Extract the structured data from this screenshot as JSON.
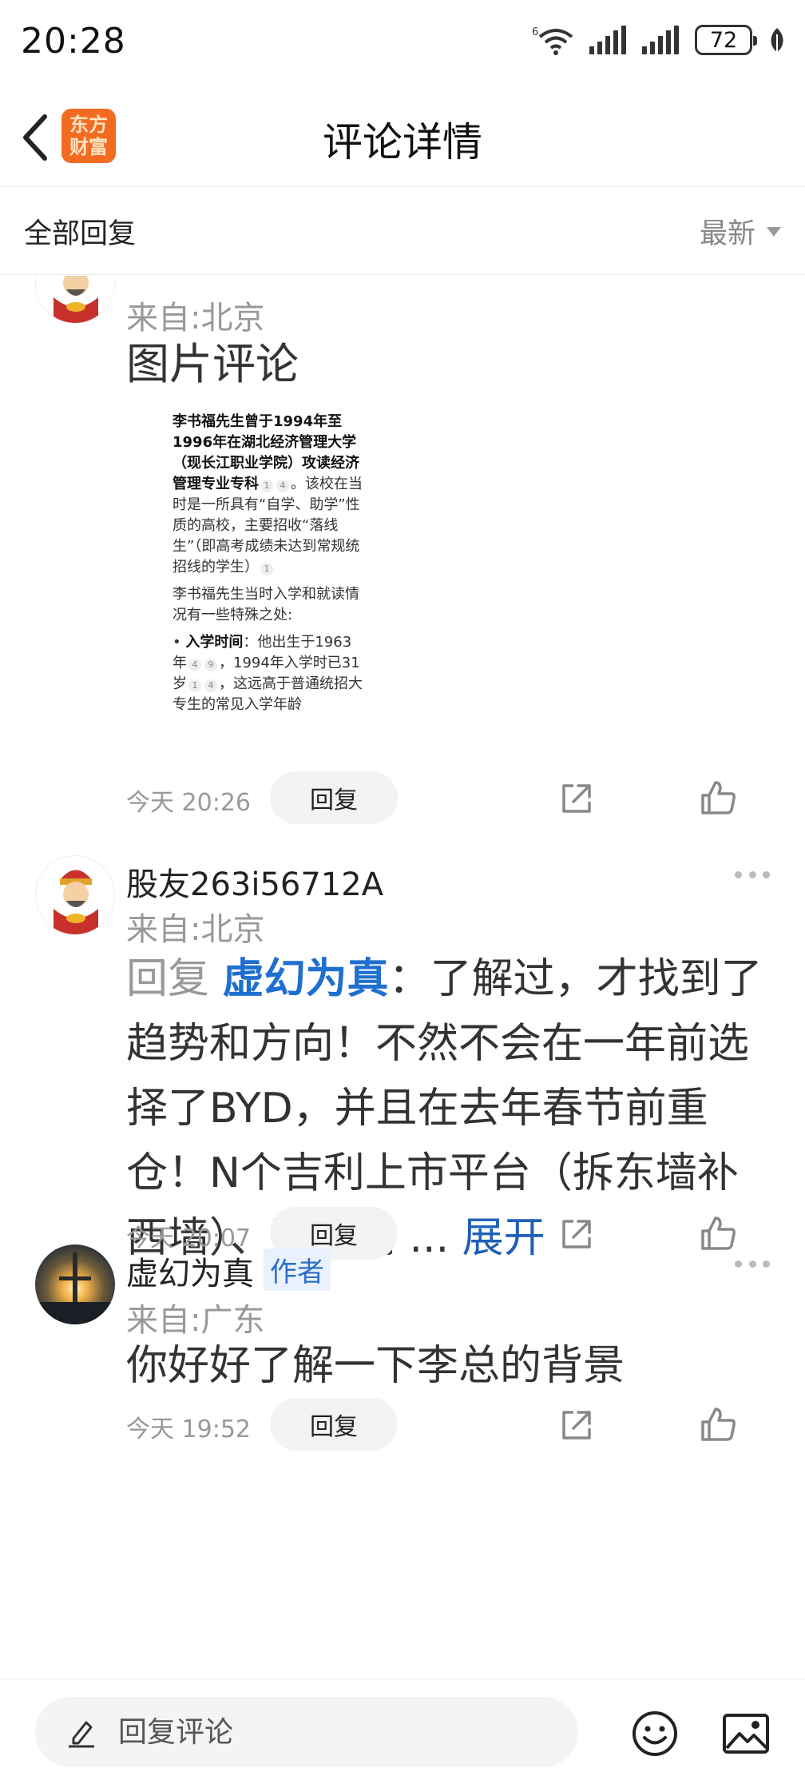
{
  "status_bar": {
    "time": "20:28",
    "network_label": "6",
    "battery": "72"
  },
  "header": {
    "title": "评论详情",
    "app_logo_line1": "东方",
    "app_logo_line2": "财富"
  },
  "filter": {
    "label": "全部回复",
    "sort": "最新"
  },
  "comments": [
    {
      "location": "来自:北京",
      "text": "图片评论",
      "image_text": {
        "p1": "李书福先生曾于1994年至1996年在湖北经济管理大学（现长江职业学院）攻读经济管理专业专科",
        "p1b": "。该校在当时是一所具有“自学、助学”性质的高校，主要招收“落线生”（即高考成绩未达到常规统招线的学生）",
        "p2": "李书福先生当时入学和就读情况有一些特殊之处:",
        "p3a": "入学时间",
        "p3b": "：他出生于1963年",
        "p3c": "，1994年入学时已31岁",
        "p3d": "，这远高于普通统招大专生的常见入学年龄"
      },
      "timestamp": "今天 20:26",
      "reply_label": "回复"
    },
    {
      "username": "股友263i56712A",
      "location": "来自:北京",
      "reply_prefix": "回复",
      "reply_target": "虚幻为真",
      "text": "：了解过，才找到了趋势和方向！不然不会在一年前选择了BYD，并且在去年春节前重仓！N个吉利上市平台（拆东墙补西墙）、研发高 ...",
      "expand": "展开",
      "timestamp": "今天 20:07",
      "reply_label": "回复"
    },
    {
      "username": "虚幻为真",
      "author_tag": "作者",
      "location": "来自:广东",
      "text": "你好好了解一下李总的背景",
      "timestamp": "今天 19:52",
      "reply_label": "回复"
    }
  ],
  "bottom_bar": {
    "placeholder": "回复评论"
  }
}
